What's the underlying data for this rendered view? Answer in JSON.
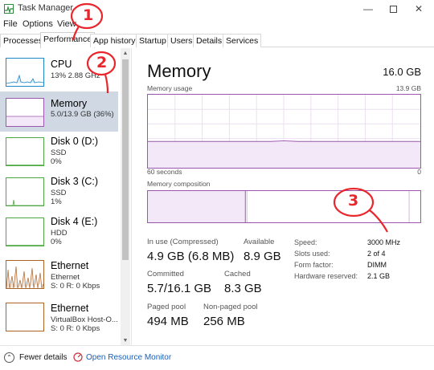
{
  "window": {
    "title": "Task Manager"
  },
  "menu": [
    "File",
    "Options",
    "View"
  ],
  "tabs": [
    "Processes",
    "Performance",
    "App history",
    "Startup",
    "Users",
    "Details",
    "Services"
  ],
  "resources": [
    {
      "name": "CPU",
      "sub1": "13%  2.88 GHz",
      "color": "#1f86c8"
    },
    {
      "name": "Memory",
      "sub1": "5.0/13.9 GB (36%)",
      "color": "#9a57ad"
    },
    {
      "name": "Disk 0 (D:)",
      "sub1": "SSD",
      "sub2": "0%",
      "color": "#4da843"
    },
    {
      "name": "Disk 3 (C:)",
      "sub1": "SSD",
      "sub2": "1%",
      "color": "#4da843"
    },
    {
      "name": "Disk 4 (E:)",
      "sub1": "HDD",
      "sub2": "0%",
      "color": "#4da843"
    },
    {
      "name": "Ethernet",
      "sub1": "Ethernet",
      "sub2": "S: 0  R: 0 Kbps",
      "color": "#a9642a"
    },
    {
      "name": "Ethernet",
      "sub1": "VirtualBox Host-O...",
      "sub2": "S: 0  R: 0 Kbps",
      "color": "#a9642a"
    }
  ],
  "memory": {
    "title": "Memory",
    "total": "16.0 GB",
    "usage_label": "Memory usage",
    "usage_max": "13.9 GB",
    "time_left": "60 seconds",
    "time_right": "0",
    "composition_label": "Memory composition",
    "in_use_label": "In use (Compressed)",
    "in_use_value": "4.9 GB (6.8 MB)",
    "available_label": "Available",
    "available_value": "8.9 GB",
    "committed_label": "Committed",
    "committed_value": "5.7/16.1 GB",
    "cached_label": "Cached",
    "cached_value": "8.3 GB",
    "paged_label": "Paged pool",
    "paged_value": "494 MB",
    "nonpaged_label": "Non-paged pool",
    "nonpaged_value": "256 MB",
    "speed_label": "Speed:",
    "speed_value": "3000 MHz",
    "slots_label": "Slots used:",
    "slots_value": "2 of 4",
    "form_label": "Form factor:",
    "form_value": "DIMM",
    "hwres_label": "Hardware reserved:",
    "hwres_value": "2.1 GB",
    "usage_level": 0.36
  },
  "footer": {
    "fewer": "Fewer details",
    "resmon": "Open Resource Monitor"
  },
  "annotations": [
    "1",
    "2",
    "3"
  ],
  "colors": {
    "memory_accent": "#9a57ad",
    "annotation": "#e8262c",
    "link": "#1a5fb4"
  }
}
